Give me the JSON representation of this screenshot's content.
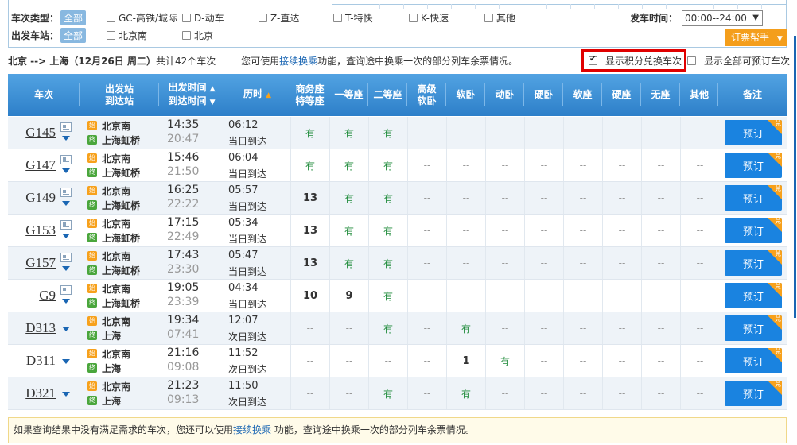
{
  "filters": {
    "type_label": "车次类型：",
    "type_all": "全部",
    "types": [
      "GC-高铁/城际",
      "D-动车",
      "Z-直达",
      "T-特快",
      "K-快速",
      "其他"
    ],
    "station_label": "出发车站：",
    "station_all": "全部",
    "stations": [
      "北京南",
      "北京"
    ],
    "depart_time_label": "发车时间：",
    "depart_time_value": "00:00--24:00",
    "help_button": "订票帮手"
  },
  "summary": {
    "route": "北京 --> 上海（12月26日 周二）",
    "count_text": "共计42个车次",
    "hint_prefix": "您可使用",
    "hint_link": "接续换乘",
    "hint_suffix": "功能，查询途中换乘一次的部分列车余票情况。",
    "points_option": "显示积分兑换车次",
    "points_checked": true,
    "all_option": "显示全部可预订车次",
    "all_checked": false
  },
  "table": {
    "headers": {
      "train": "车次",
      "from": "出发站",
      "to": "到达站",
      "dep_time": "出发时间",
      "arr_time": "到达时间",
      "duration": "历时",
      "business_1": "商务座",
      "business_2": "特等座",
      "first": "一等座",
      "second": "二等座",
      "hsoft_1": "高级",
      "hsoft_2": "软卧",
      "soft_sleeper": "软卧",
      "motor_sleeper": "动卧",
      "hard_sleeper": "硬卧",
      "soft_seat": "软座",
      "hard_seat": "硬座",
      "no_seat": "无座",
      "other": "其他",
      "remark": "备注"
    },
    "start_badge": "始",
    "end_badge": "终",
    "book_label": "预订",
    "corner_label": "兑",
    "rows": [
      {
        "train": "G145",
        "info": true,
        "from": "北京南",
        "to": "上海虹桥",
        "dep": "14:35",
        "arr": "20:47",
        "dur": "06:12",
        "day": "当日到达",
        "seats": [
          "有",
          "有",
          "有",
          "--",
          "--",
          "--",
          "--",
          "--",
          "--",
          "--",
          "--"
        ]
      },
      {
        "train": "G147",
        "info": true,
        "from": "北京南",
        "to": "上海虹桥",
        "dep": "15:46",
        "arr": "21:50",
        "dur": "06:04",
        "day": "当日到达",
        "seats": [
          "有",
          "有",
          "有",
          "--",
          "--",
          "--",
          "--",
          "--",
          "--",
          "--",
          "--"
        ]
      },
      {
        "train": "G149",
        "info": true,
        "from": "北京南",
        "to": "上海虹桥",
        "dep": "16:25",
        "arr": "22:22",
        "dur": "05:57",
        "day": "当日到达",
        "seats": [
          "13",
          "有",
          "有",
          "--",
          "--",
          "--",
          "--",
          "--",
          "--",
          "--",
          "--"
        ]
      },
      {
        "train": "G153",
        "info": true,
        "from": "北京南",
        "to": "上海虹桥",
        "dep": "17:15",
        "arr": "22:49",
        "dur": "05:34",
        "day": "当日到达",
        "seats": [
          "13",
          "有",
          "有",
          "--",
          "--",
          "--",
          "--",
          "--",
          "--",
          "--",
          "--"
        ]
      },
      {
        "train": "G157",
        "info": true,
        "from": "北京南",
        "to": "上海虹桥",
        "dep": "17:43",
        "arr": "23:30",
        "dur": "05:47",
        "day": "当日到达",
        "seats": [
          "13",
          "有",
          "有",
          "--",
          "--",
          "--",
          "--",
          "--",
          "--",
          "--",
          "--"
        ]
      },
      {
        "train": "G9",
        "info": true,
        "from": "北京南",
        "to": "上海虹桥",
        "dep": "19:05",
        "arr": "23:39",
        "dur": "04:34",
        "day": "当日到达",
        "seats": [
          "10",
          "9",
          "有",
          "--",
          "--",
          "--",
          "--",
          "--",
          "--",
          "--",
          "--"
        ]
      },
      {
        "train": "D313",
        "info": false,
        "from": "北京南",
        "to": "上海",
        "dep": "19:34",
        "arr": "07:41",
        "dur": "12:07",
        "day": "次日到达",
        "seats": [
          "--",
          "--",
          "有",
          "--",
          "有",
          "--",
          "--",
          "--",
          "--",
          "--",
          "--"
        ]
      },
      {
        "train": "D311",
        "info": false,
        "from": "北京南",
        "to": "上海",
        "dep": "21:16",
        "arr": "09:08",
        "dur": "11:52",
        "day": "次日到达",
        "seats": [
          "--",
          "--",
          "--",
          "--",
          "1",
          "有",
          "--",
          "--",
          "--",
          "--",
          "--"
        ]
      },
      {
        "train": "D321",
        "info": false,
        "from": "北京南",
        "to": "上海",
        "dep": "21:23",
        "arr": "09:13",
        "dur": "11:50",
        "day": "次日到达",
        "seats": [
          "--",
          "--",
          "有",
          "--",
          "有",
          "--",
          "--",
          "--",
          "--",
          "--",
          "--"
        ]
      }
    ]
  },
  "footer": {
    "prefix": "如果查询结果中没有满足需求的车次，您还可以使用",
    "link": "接续换乘",
    "suffix": " 功能，查询途中换乘一次的部分列车余票情况。"
  }
}
